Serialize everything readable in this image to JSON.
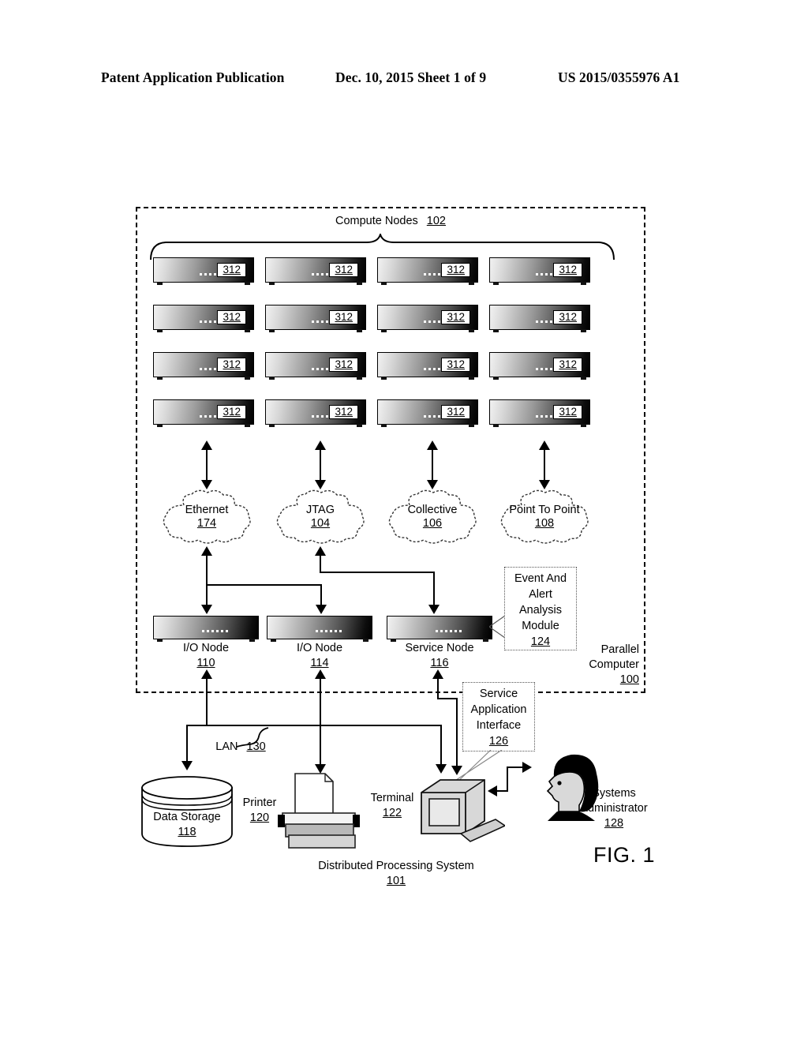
{
  "header": {
    "publication": "Patent Application Publication",
    "date_sheet": "Dec. 10, 2015  Sheet 1 of 9",
    "patent_number": "US 2015/0355976 A1"
  },
  "figure": {
    "label": "FIG. 1",
    "system_title": "Distributed Processing System",
    "system_ref": "101"
  },
  "parallel_computer": {
    "title": "Parallel",
    "title2": "Computer",
    "ref": "100"
  },
  "compute_nodes": {
    "title": "Compute Nodes",
    "ref": "102",
    "node_label": "312",
    "rows": 4,
    "cols": 4,
    "nodes": [
      {
        "label": "312"
      },
      {
        "label": "312"
      },
      {
        "label": "312"
      },
      {
        "label": "312"
      },
      {
        "label": "312"
      },
      {
        "label": "312"
      },
      {
        "label": "312"
      },
      {
        "label": "312"
      },
      {
        "label": "312"
      },
      {
        "label": "312"
      },
      {
        "label": "312"
      },
      {
        "label": "312"
      },
      {
        "label": "312"
      },
      {
        "label": "312"
      },
      {
        "label": "312"
      },
      {
        "label": "312"
      }
    ]
  },
  "networks": [
    {
      "name": "Ethernet",
      "ref": "174"
    },
    {
      "name": "JTAG",
      "ref": "104"
    },
    {
      "name": "Collective",
      "ref": "106"
    },
    {
      "name": "Point To Point",
      "ref": "108"
    }
  ],
  "service_nodes": [
    {
      "name": "I/O Node",
      "ref": "110"
    },
    {
      "name": "I/O Node",
      "ref": "114"
    },
    {
      "name": "Service Node",
      "ref": "116"
    }
  ],
  "event_module": {
    "line1": "Event And",
    "line2": "Alert",
    "line3": "Analysis",
    "line4": "Module",
    "ref": "124"
  },
  "service_app_interface": {
    "line1": "Service",
    "line2": "Application",
    "line3": "Interface",
    "ref": "126"
  },
  "lan": {
    "name": "LAN",
    "ref": "130"
  },
  "peripherals": [
    {
      "name": "Data Storage",
      "ref": "118"
    },
    {
      "name": "Printer",
      "ref": "120"
    },
    {
      "name": "Terminal",
      "ref": "122"
    }
  ],
  "administrator": {
    "line1": "Systems",
    "line2": "Administrator",
    "ref": "128"
  }
}
